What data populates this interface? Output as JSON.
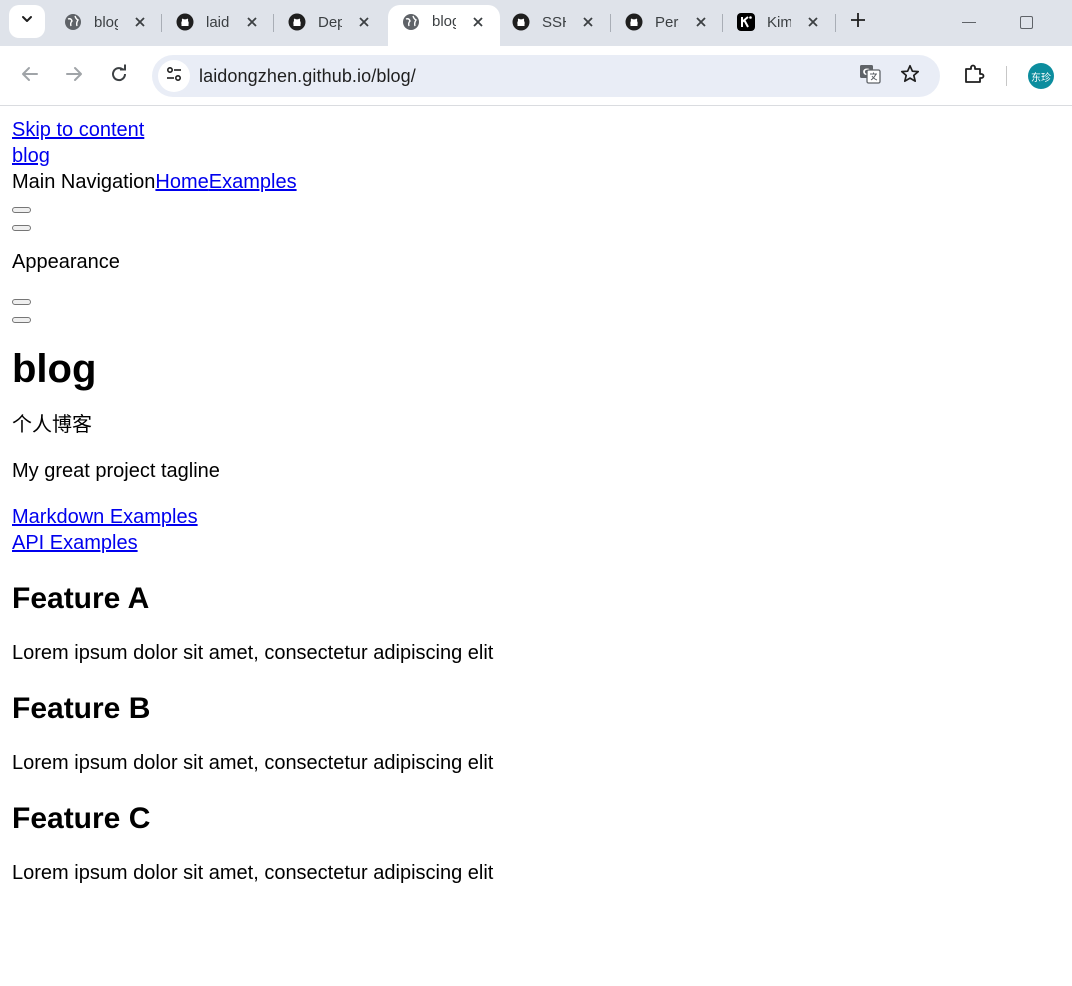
{
  "browser": {
    "tabs": [
      {
        "title": "blog",
        "icon": "globe-icon",
        "active": false
      },
      {
        "title": "laidongzhen",
        "icon": "github-icon",
        "active": false
      },
      {
        "title": "Deploy",
        "icon": "github-icon",
        "active": false
      },
      {
        "title": "blog",
        "icon": "globe-icon",
        "active": true
      },
      {
        "title": "SSH",
        "icon": "github-icon",
        "active": false
      },
      {
        "title": "Personal",
        "icon": "github-icon",
        "active": false
      },
      {
        "title": "Kimi",
        "icon": "kimi-icon",
        "active": false
      }
    ],
    "url": "laidongzhen.github.io/blog/",
    "profile_initials": "东珍",
    "colors": {
      "tabstrip": "#dfe3ea",
      "omnibox": "#e9edf6",
      "avatar": "#0c8d9e",
      "link": "#0000ee"
    }
  },
  "page": {
    "skip_link": "Skip to content",
    "site_title": "blog",
    "nav_label": "Main Navigation",
    "nav_items": [
      "Home",
      "Examples"
    ],
    "appearance_label": "Appearance",
    "hero": {
      "name": "blog",
      "text": "个人博客",
      "tagline": "My great project tagline",
      "actions": [
        "Markdown Examples",
        "API Examples"
      ]
    },
    "features": [
      {
        "title": "Feature A",
        "details": "Lorem ipsum dolor sit amet, consectetur adipiscing elit"
      },
      {
        "title": "Feature B",
        "details": "Lorem ipsum dolor sit amet, consectetur adipiscing elit"
      },
      {
        "title": "Feature C",
        "details": "Lorem ipsum dolor sit amet, consectetur adipiscing elit"
      }
    ]
  }
}
